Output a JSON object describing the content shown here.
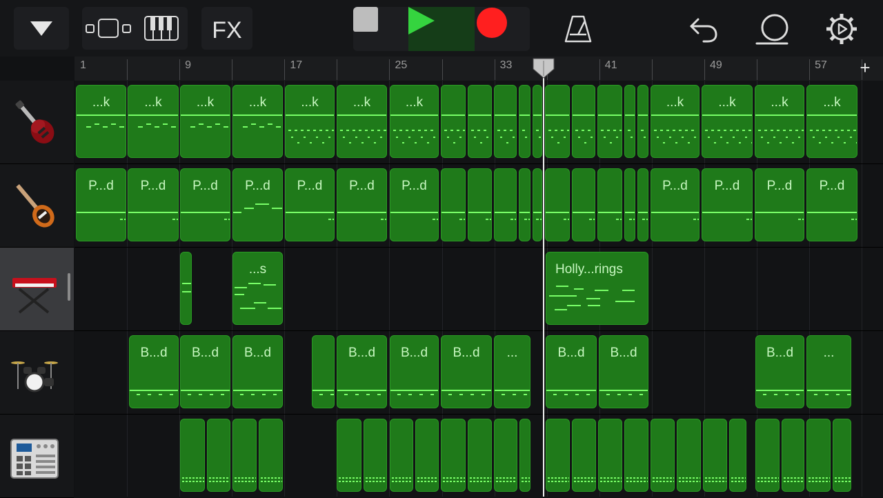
{
  "toolbar": {
    "fx_label": "FX",
    "icons": {
      "browser": "triangle-down-icon",
      "tracks": "tracks-view-icon",
      "instrument": "keyboard-icon",
      "stop": "stop-icon",
      "play": "play-icon",
      "record": "record-icon",
      "metronome": "metronome-icon",
      "undo": "undo-icon",
      "loop": "loop-icon",
      "settings": "gear-icon"
    },
    "colors": {
      "play": "#35d43f",
      "record": "#ff1f1f",
      "stop": "#bdbdbd"
    }
  },
  "ruler": {
    "bar_labels": [
      "1",
      "9",
      "17",
      "25",
      "33",
      "41",
      "49",
      "57"
    ],
    "add_track_label": "+"
  },
  "tracks": [
    {
      "name": "electric-guitar",
      "icon": "electric-guitar-icon"
    },
    {
      "name": "bass",
      "icon": "bass-guitar-icon"
    },
    {
      "name": "keyboard",
      "icon": "keyboard-stand-icon",
      "selected": true
    },
    {
      "name": "drums",
      "icon": "drum-kit-icon"
    },
    {
      "name": "beat-sequencer",
      "icon": "drum-machine-icon"
    }
  ],
  "regions": {
    "guitar": [
      "...k",
      "...k",
      "...k",
      "...k",
      "...k",
      "...k",
      "...k",
      "...k",
      "...k",
      "...k",
      "...k"
    ],
    "bass": [
      "P...d",
      "P...d",
      "P...d",
      "P...d",
      "P...d",
      "P...d",
      "P...d",
      "P...d",
      "P...d",
      "P...d",
      "P...d"
    ],
    "keys": [
      "...s",
      "Holly...rings"
    ],
    "drums": [
      "B...d",
      "B...d",
      "B...d",
      "B...d",
      "B...d",
      "B...d",
      "...",
      "B...d",
      "B...d",
      "B...d",
      "..."
    ]
  },
  "colors": {
    "region_fill": "#1f7a1a",
    "note": "#79ff68",
    "region_text": "#c7f7c0"
  }
}
